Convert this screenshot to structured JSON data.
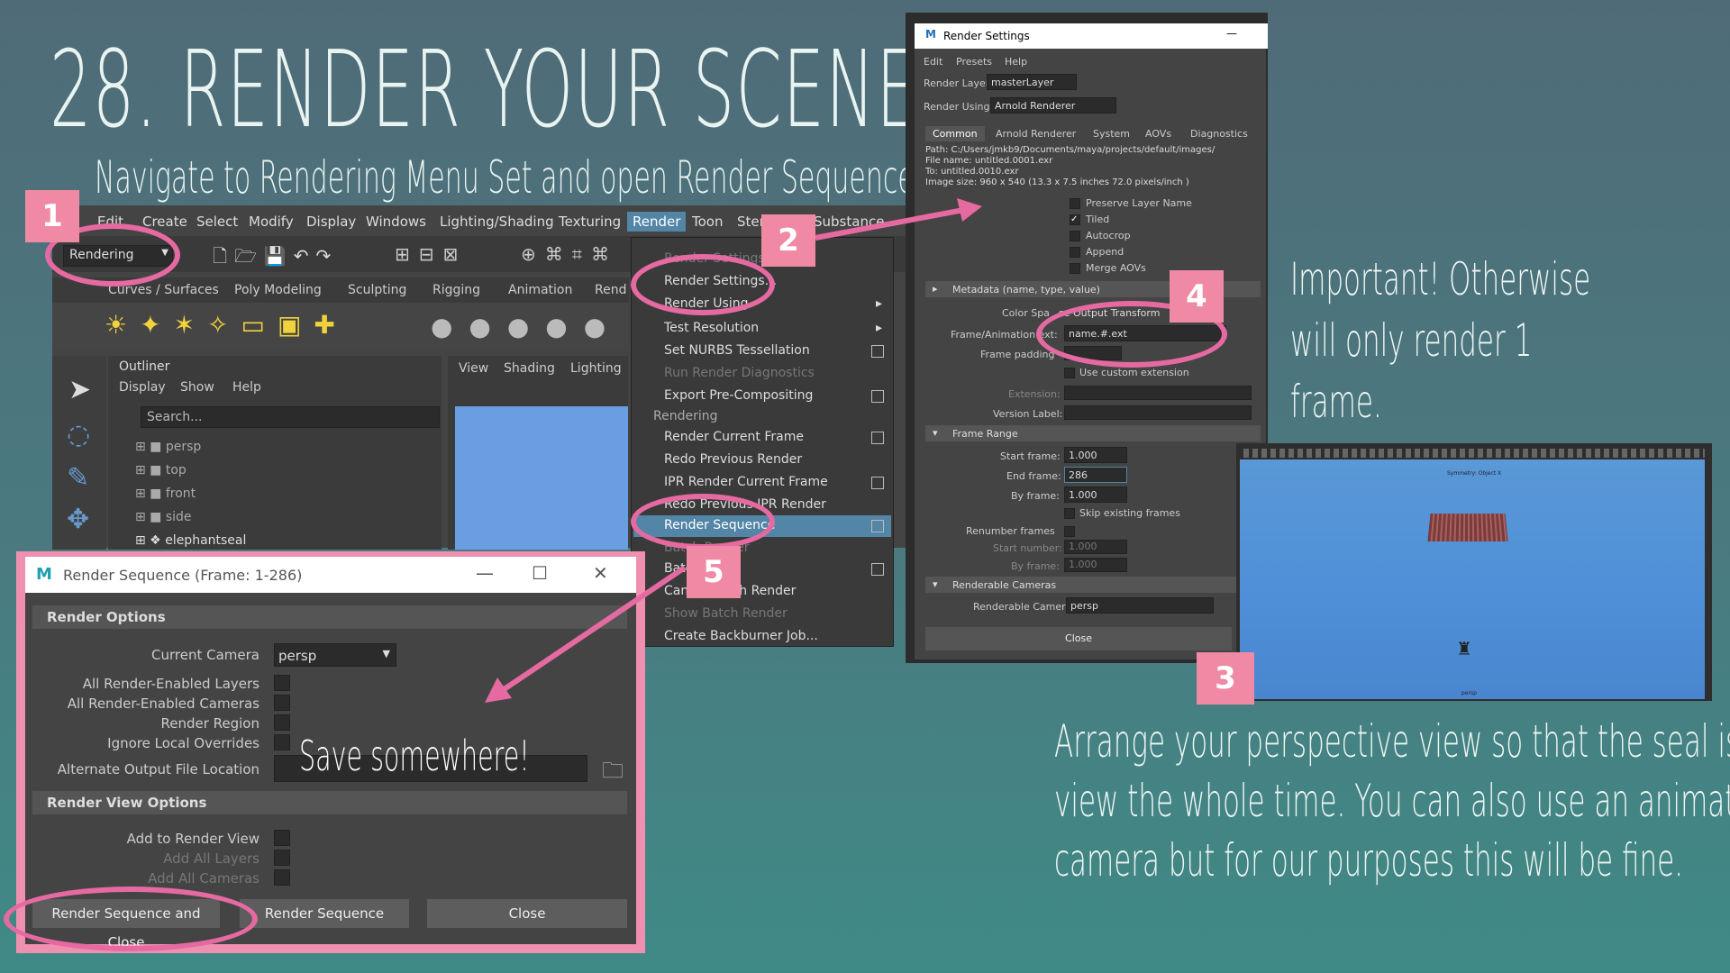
{
  "slide": {
    "title": "28. RENDER YOUR SCENE",
    "subtitle": "Navigate to Rendering Menu Set and open Render Sequence settings.",
    "note_important": [
      "Important! Otherwise",
      "will only render 1",
      "frame."
    ],
    "note_arrange": [
      "Arrange your perspective view so that the seal is in",
      "view the whole time. You can also use an animated",
      "camera but for our purposes this will be fine."
    ],
    "save_note": "Save somewhere!",
    "badges": [
      "1",
      "2",
      "3",
      "4",
      "5"
    ]
  },
  "maya": {
    "menu": [
      "Edit",
      "Create",
      "Select",
      "Modify",
      "Display",
      "Windows",
      "Lighting/Shading",
      "Texturing",
      "Render",
      "Toon",
      "Ster",
      "he",
      "Substance"
    ],
    "menu_set": "Rendering",
    "shelf_tabs": [
      "Curves / Surfaces",
      "Poly Modeling",
      "Sculpting",
      "Rigging",
      "Animation",
      "Rend"
    ],
    "viewport_menu": [
      "View",
      "Shading",
      "Lighting"
    ],
    "outliner": {
      "title": "Outliner",
      "menu": [
        "Display",
        "Show",
        "Help"
      ],
      "search_placeholder": "Search...",
      "items": [
        "persp",
        "top",
        "front",
        "side",
        "elephantseal"
      ]
    }
  },
  "render_menu": {
    "items": [
      {
        "label": "Render Settings",
        "disabled": true
      },
      {
        "label": "Render Settings...",
        "disabled": false
      },
      {
        "label": "Render Using",
        "disabled": false
      },
      {
        "label": "Test Resolution",
        "disabled": false
      },
      {
        "label": "Set NURBS Tessellation",
        "disabled": false
      },
      {
        "label": "Run Render Diagnostics",
        "disabled": true
      },
      {
        "label": "Export Pre-Compositing",
        "disabled": false
      },
      {
        "label": "Rendering",
        "section": true
      },
      {
        "label": "Render Current Frame",
        "disabled": false
      },
      {
        "label": "Redo Previous Render",
        "disabled": false
      },
      {
        "label": "IPR Render Current Frame",
        "disabled": false
      },
      {
        "label": "Redo Previous IPR Render",
        "disabled": false
      },
      {
        "label": "Render Sequence",
        "highlighted": true
      },
      {
        "label": "Batch Render",
        "disabled": true
      },
      {
        "label": "Batch",
        "disabled": false
      },
      {
        "label": "Cancel Batch Render",
        "disabled": false
      },
      {
        "label": "Show Batch Render",
        "disabled": true
      },
      {
        "label": "Create Backburner Job...",
        "disabled": false
      }
    ]
  },
  "render_settings": {
    "window_title": "Render Settings",
    "menu": [
      "Edit",
      "Presets",
      "Help"
    ],
    "render_layer_label": "Render Layer",
    "render_layer": "masterLayer",
    "render_using_label": "Render Using",
    "render_using": "Arnold Renderer",
    "tabs": [
      "Common",
      "Arnold Renderer",
      "System",
      "AOVs",
      "Diagnostics"
    ],
    "info": [
      "Path: C:/Users/jmkb9/Documents/maya/projects/default/images/",
      "File name:  untitled.0001.exr",
      "To:         untitled.0010.exr",
      "Image size: 960 x 540 (13.3 x 7.5 inches 72.0 pixels/inch )"
    ],
    "options": [
      {
        "label": "Preserve Layer Name",
        "checked": false
      },
      {
        "label": "Tiled",
        "checked": true
      },
      {
        "label": "Autocrop",
        "checked": false
      },
      {
        "label": "Append",
        "checked": false
      },
      {
        "label": "Merge AOVs",
        "checked": false
      }
    ],
    "metadata_section": "Metadata (name, type, value)",
    "color_space_label": "Color Spa",
    "color_space": "se Output Transform",
    "frame_ext_label": "Frame/Animation ext:",
    "frame_ext": "name.#.ext",
    "frame_padding_label": "Frame padding",
    "use_custom_ext": "Use custom extension",
    "extension_label": "Extension:",
    "version_label": "Version Label:",
    "frame_range_section": "Frame Range",
    "start_frame_label": "Start frame:",
    "start_frame": "1.000",
    "end_frame_label": "End frame:",
    "end_frame": "286",
    "by_frame_label": "By frame:",
    "by_frame": "1.000",
    "skip_existing": "Skip existing frames",
    "renumber_label": "Renumber frames",
    "start_number_label": "Start number:",
    "start_number": "1.000",
    "by_frame2_label": "By frame:",
    "by_frame2": "1.000",
    "cameras_section": "Renderable Cameras",
    "renderable_camera_label": "Renderable Camera",
    "renderable_camera": "persp",
    "close": "Close"
  },
  "seal_view": {
    "caption": "Symmetry: Object X",
    "footer": "persp"
  },
  "render_sequence": {
    "window_title": "Render Sequence (Frame: 1-286)",
    "render_options": "Render Options",
    "current_camera_label": "Current Camera",
    "current_camera": "persp",
    "options": [
      "All Render-Enabled Layers",
      "All Render-Enabled Cameras",
      "Render Region",
      "Ignore Local Overrides"
    ],
    "alt_output_label": "Alternate Output File Location",
    "render_view_options": "Render View Options",
    "view_options": [
      {
        "label": "Add to Render View",
        "disabled": false
      },
      {
        "label": "Add All Layers",
        "disabled": true
      },
      {
        "label": "Add All Cameras",
        "disabled": true
      }
    ],
    "buttons": [
      "Render Sequence and Close",
      "Render Sequence",
      "Close"
    ]
  }
}
